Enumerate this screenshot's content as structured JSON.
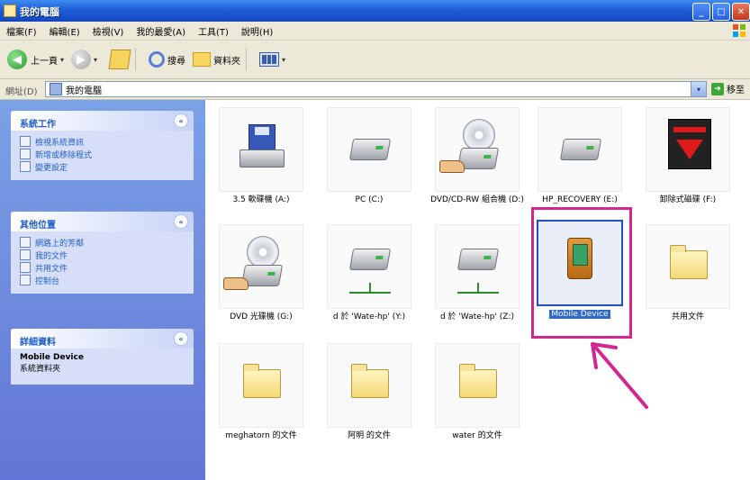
{
  "window": {
    "title": "我的電腦"
  },
  "title_buttons": {
    "minimize": "_",
    "maximize": "□",
    "close": "✕"
  },
  "menu": [
    "檔案(F)",
    "編輯(E)",
    "檢視(V)",
    "我的最愛(A)",
    "工具(T)",
    "說明(H)"
  ],
  "toolbar": {
    "back_label": "上一頁",
    "search_label": "搜尋",
    "folders_label": "資料夾",
    "caret": "▾"
  },
  "address": {
    "label": "網址(D)",
    "value": "我的電腦",
    "go_label": "移至",
    "dropdown": "▾"
  },
  "panels": {
    "system_tasks": {
      "title": "系統工作",
      "items": [
        "檢視系統資訊",
        "新增或移除程式",
        "變更設定"
      ]
    },
    "other_places": {
      "title": "其他位置",
      "items": [
        "網路上的芳鄰",
        "我的文件",
        "共用文件",
        "控制台"
      ]
    },
    "details": {
      "title": "詳細資料",
      "name": "Mobile Device",
      "type": "系統資料夾"
    },
    "collapse_glyph": "«"
  },
  "items": [
    {
      "label": "3.5 軟碟機 (A:)",
      "icon": "floppy-drive-icon"
    },
    {
      "label": "PC (C:)",
      "icon": "hard-drive-icon"
    },
    {
      "label": "DVD/CD-RW 組合機 (D:)",
      "icon": "dvd-cdrw-icon"
    },
    {
      "label": "HP_RECOVERY (E:)",
      "icon": "hard-drive-icon"
    },
    {
      "label": "卸除式磁碟 (F:)",
      "icon": "removable-disk-icon"
    },
    {
      "label": "DVD 光碟機 (G:)",
      "icon": "dvd-drive-icon"
    },
    {
      "label": "d 於 'Wate-hp' (Y:)",
      "icon": "network-drive-icon"
    },
    {
      "label": "d 於 'Wate-hp' (Z:)",
      "icon": "network-drive-icon"
    },
    {
      "label": "Mobile Device",
      "icon": "mobile-device-icon"
    },
    {
      "label": "共用文件",
      "icon": "folder-icon"
    },
    {
      "label": "meghatorn 的文件",
      "icon": "folder-icon"
    },
    {
      "label": "阿明 的文件",
      "icon": "folder-icon"
    },
    {
      "label": "water 的文件",
      "icon": "folder-icon"
    }
  ],
  "accent": {
    "highlight": "#d4268f",
    "selection": "#3169c6"
  }
}
